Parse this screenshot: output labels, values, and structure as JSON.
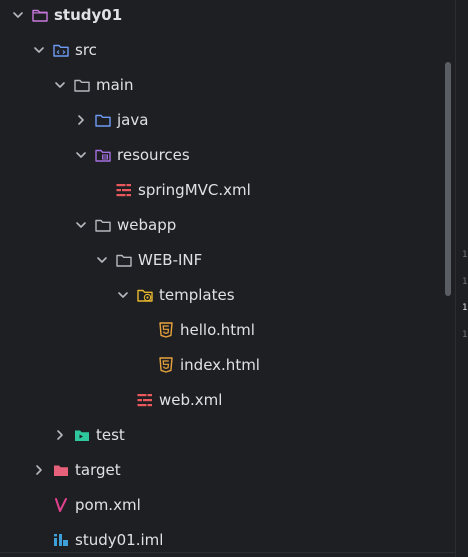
{
  "tree": {
    "items": [
      {
        "label": "study01",
        "icon": "module-folder-icon",
        "chevron": "down",
        "bold": true
      },
      {
        "label": "src",
        "icon": "source-root-icon",
        "chevron": "down"
      },
      {
        "label": "main",
        "icon": "folder-icon",
        "chevron": "down"
      },
      {
        "label": "java",
        "icon": "source-folder-icon",
        "chevron": "right"
      },
      {
        "label": "resources",
        "icon": "resources-folder-icon",
        "chevron": "down"
      },
      {
        "label": "springMVC.xml",
        "icon": "spring-xml-icon",
        "chevron": "none"
      },
      {
        "label": "webapp",
        "icon": "folder-icon",
        "chevron": "down"
      },
      {
        "label": "WEB-INF",
        "icon": "folder-icon",
        "chevron": "down"
      },
      {
        "label": "templates",
        "icon": "web-folder-icon",
        "chevron": "down"
      },
      {
        "label": "hello.html",
        "icon": "html5-icon",
        "chevron": "none"
      },
      {
        "label": "index.html",
        "icon": "html5-icon",
        "chevron": "none"
      },
      {
        "label": "web.xml",
        "icon": "web-xml-icon",
        "chevron": "none"
      },
      {
        "label": "test",
        "icon": "test-folder-icon",
        "chevron": "right"
      },
      {
        "label": "target",
        "icon": "excluded-folder-icon",
        "chevron": "right"
      },
      {
        "label": "pom.xml",
        "icon": "maven-icon",
        "chevron": "none"
      },
      {
        "label": "study01.iml",
        "icon": "iml-file-icon",
        "chevron": "none"
      }
    ]
  },
  "gutter": {
    "numbers": [
      "1",
      "1",
      "1",
      "1"
    ]
  },
  "colors": {
    "background": "#1e1f22",
    "text": "#dfe1e5",
    "chevron": "#b4b8bf",
    "module_folder": "#c678dd",
    "source_root": "#6e9bf5",
    "resources": "#a46fe0",
    "spring_xml": "#e8585d",
    "web_folder": "#e8b72e",
    "html5": "#e8a33d",
    "test_folder": "#2fc79e",
    "excluded_folder": "#e8617a",
    "maven": "#e2418f",
    "iml": "#3e9fd9"
  }
}
